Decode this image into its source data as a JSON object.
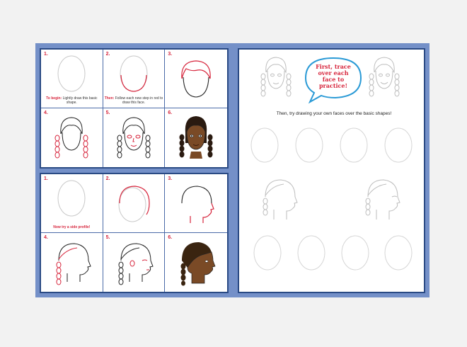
{
  "colors": {
    "accent_red": "#d7263d",
    "border_blue": "#2a4a84",
    "background_blue": "#7490c8",
    "skin_brown": "#6b4422"
  },
  "top_panel": {
    "steps": [
      {
        "number": "1.",
        "caption_lead": "To begin:",
        "caption_rest": "Lightly draw this basic shape."
      },
      {
        "number": "2.",
        "caption_lead": "Then:",
        "caption_rest": "Follow each new step in red to draw this face."
      },
      {
        "number": "3."
      },
      {
        "number": "4."
      },
      {
        "number": "5."
      },
      {
        "number": "6."
      }
    ]
  },
  "bottom_panel": {
    "steps": [
      {
        "number": "1.",
        "caption": "Now try a side profile!"
      },
      {
        "number": "2."
      },
      {
        "number": "3."
      },
      {
        "number": "4."
      },
      {
        "number": "5."
      },
      {
        "number": "6."
      }
    ]
  },
  "practice_page": {
    "bubble_text": "First, trace over each face to practice!",
    "instruction": "Then, try drawing your own faces over the basic shapes!"
  }
}
